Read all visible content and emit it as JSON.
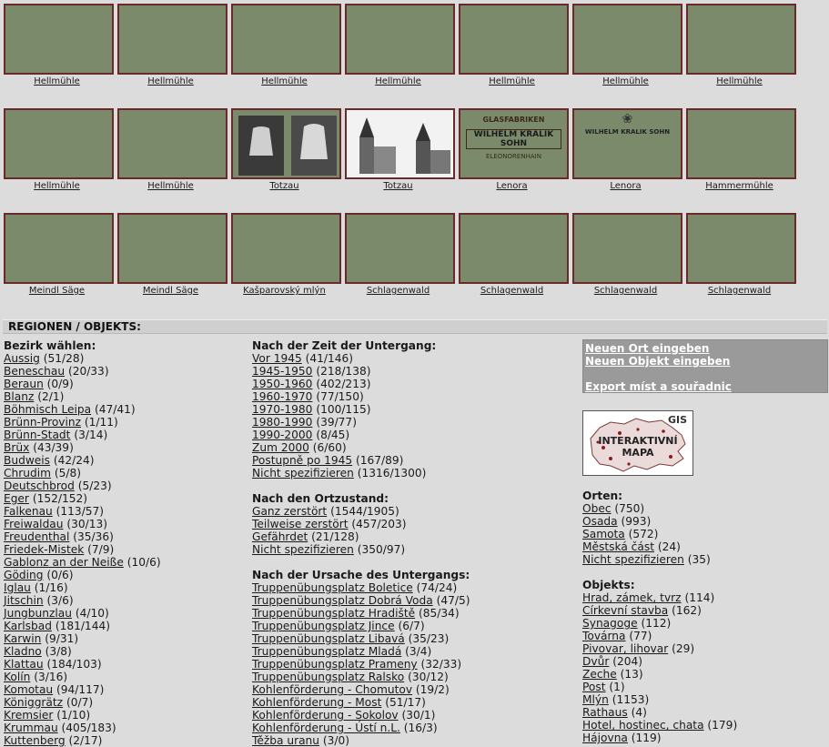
{
  "gallery": {
    "rows": [
      [
        {
          "caption": "Hellmühle",
          "img": "forest1"
        },
        {
          "caption": "Hellmühle",
          "img": "forest2"
        },
        {
          "caption": "Hellmühle",
          "img": "forest3"
        },
        {
          "caption": "Hellmühle",
          "img": "path"
        },
        {
          "caption": "Hellmühle",
          "img": "lake"
        },
        {
          "caption": "Hellmühle",
          "img": "light"
        },
        {
          "caption": "Hellmühle",
          "img": "green"
        }
      ],
      [
        {
          "caption": "Hellmühle",
          "img": "bw1"
        },
        {
          "caption": "Hellmühle",
          "img": "map"
        },
        {
          "caption": "Totzau",
          "img": "bells"
        },
        {
          "caption": "Totzau",
          "img": "church"
        },
        {
          "caption": "Lenora",
          "img": "label"
        },
        {
          "caption": "Lenora",
          "img": "label2"
        },
        {
          "caption": "Hammermühle",
          "img": "post"
        }
      ],
      [
        {
          "caption": "Meindl Säge",
          "img": "hills1"
        },
        {
          "caption": "Meindl Säge",
          "img": "hills2"
        },
        {
          "caption": "Kašparovský mlýn",
          "img": "sketch"
        },
        {
          "caption": "Schlagenwald",
          "img": "bldg"
        },
        {
          "caption": "Schlagenwald",
          "img": "town"
        },
        {
          "caption": "Schlagenwald",
          "img": "street"
        },
        {
          "caption": "Schlagenwald",
          "img": "street2"
        }
      ]
    ],
    "label_texts": {
      "glas": "GLASFABRIKEN",
      "wks": "WILHELM KRALIK SOHN",
      "eleo": "ELEONORENHAIN",
      "wks2": "WILHELM KRALIK SOHN"
    }
  },
  "section_title": "REGIONEN / OBJEKTS:",
  "bezirk": {
    "heading": "Bezirk wählen:",
    "items": [
      {
        "name": "Aussig",
        "count": "(51/28)"
      },
      {
        "name": "Beneschau",
        "count": "(20/33)"
      },
      {
        "name": "Beraun",
        "count": "(0/9)"
      },
      {
        "name": "Blanz",
        "count": "(2/1)"
      },
      {
        "name": "Böhmisch Leipa",
        "count": "(47/41)"
      },
      {
        "name": "Brünn-Provinz",
        "count": "(1/11)"
      },
      {
        "name": "Brünn-Stadt",
        "count": "(3/14)"
      },
      {
        "name": "Brüx",
        "count": "(43/39)"
      },
      {
        "name": "Budweis",
        "count": "(42/24)"
      },
      {
        "name": "Chrudim",
        "count": "(5/8)"
      },
      {
        "name": "Deutschbrod",
        "count": "(5/23)"
      },
      {
        "name": "Eger",
        "count": "(152/152)"
      },
      {
        "name": "Falkenau",
        "count": "(113/57)"
      },
      {
        "name": "Freiwaldau",
        "count": "(30/13)"
      },
      {
        "name": "Freudenthal",
        "count": "(35/36)"
      },
      {
        "name": "Friedek-Mistek",
        "count": "(7/9)"
      },
      {
        "name": "Gablonz an der Neiße",
        "count": "(10/6)"
      },
      {
        "name": "Göding",
        "count": "(0/6)"
      },
      {
        "name": "Iglau",
        "count": "(1/16)"
      },
      {
        "name": "Jitschin",
        "count": "(3/6)"
      },
      {
        "name": "Jungbunzlau",
        "count": "(4/10)"
      },
      {
        "name": "Karlsbad",
        "count": "(181/144)"
      },
      {
        "name": "Karwin",
        "count": "(9/31)"
      },
      {
        "name": "Kladno",
        "count": "(3/8)"
      },
      {
        "name": "Klattau",
        "count": "(184/103)"
      },
      {
        "name": "Kolín",
        "count": "(3/16)"
      },
      {
        "name": "Komotau",
        "count": "(94/117)"
      },
      {
        "name": "Königgrätz",
        "count": "(0/7)"
      },
      {
        "name": "Kremsier",
        "count": "(1/10)"
      },
      {
        "name": "Krummau",
        "count": "(405/183)"
      },
      {
        "name": "Kuttenberg",
        "count": "(2/17)"
      }
    ]
  },
  "zeit": {
    "heading": "Nach der Zeit der Untergang:",
    "items": [
      {
        "name": "Vor 1945",
        "count": "(41/146)"
      },
      {
        "name": "1945-1950",
        "count": "(218/138)"
      },
      {
        "name": "1950-1960",
        "count": "(402/213)"
      },
      {
        "name": "1960-1970",
        "count": "(77/150)"
      },
      {
        "name": "1970-1980",
        "count": "(100/115)"
      },
      {
        "name": "1980-1990",
        "count": "(39/77)"
      },
      {
        "name": "1990-2000",
        "count": "(8/45)"
      },
      {
        "name": "Zum 2000",
        "count": "(6/60)"
      },
      {
        "name": "Postupně po 1945",
        "count": "(167/89)"
      },
      {
        "name": "Nicht spezifizieren",
        "count": "(1316/1300)"
      }
    ]
  },
  "zustand": {
    "heading": "Nach den Ortzustand:",
    "items": [
      {
        "name": "Ganz zerstört",
        "count": "(1544/1905)"
      },
      {
        "name": "Teilweise zerstört",
        "count": "(457/203)"
      },
      {
        "name": "Gefährdet",
        "count": "(21/128)"
      },
      {
        "name": "Nicht spezifizieren",
        "count": "(350/97)"
      }
    ]
  },
  "ursache": {
    "heading": "Nach der Ursache des Untergangs:",
    "items": [
      {
        "name": "Truppenübungsplatz Boletice",
        "count": "(74/24)"
      },
      {
        "name": "Truppenübungsplatz Dobrá Voda",
        "count": "(47/5)"
      },
      {
        "name": "Truppenübungsplatz Hradiště",
        "count": "(85/34)"
      },
      {
        "name": "Truppenübungsplatz Jince",
        "count": "(6/7)"
      },
      {
        "name": "Truppenübungsplatz Libavá",
        "count": "(35/23)"
      },
      {
        "name": "Truppenübungsplatz Mladá",
        "count": "(3/4)"
      },
      {
        "name": "Truppenübungsplatz Prameny",
        "count": "(32/33)"
      },
      {
        "name": "Truppenübungsplatz Ralsko",
        "count": "(30/12)"
      },
      {
        "name": "Kohlenförderung - Chomutov",
        "count": "(19/2)"
      },
      {
        "name": "Kohlenförderung - Most",
        "count": "(51/17)"
      },
      {
        "name": "Kohlenförderung - Sokolov",
        "count": "(30/1)"
      },
      {
        "name": "Kohlenförderung - Ústí n.L.",
        "count": "(16/3)"
      },
      {
        "name": "Těžba uranu",
        "count": "(3/0)"
      }
    ]
  },
  "menu": {
    "items": [
      "Neuen Ort eingeben",
      "Neuen Objekt eingeben",
      "Export míst a souřadnic"
    ]
  },
  "gis": {
    "line1": "GIS",
    "line2": "INTERAKTIVNÍ",
    "line3": "MAPA"
  },
  "orten": {
    "heading": "Orten:",
    "items": [
      {
        "name": "Obec",
        "count": "(750)"
      },
      {
        "name": "Osada",
        "count": "(993)"
      },
      {
        "name": "Samota",
        "count": "(572)"
      },
      {
        "name": "Městská část",
        "count": "(24)"
      },
      {
        "name": "Nicht spezifizieren",
        "count": "(35)"
      }
    ]
  },
  "objekts": {
    "heading": "Objekts:",
    "items": [
      {
        "name": "Hrad, zámek, tvrz",
        "count": "(114)"
      },
      {
        "name": "Církevní stavba",
        "count": "(162)"
      },
      {
        "name": "Synagoge",
        "count": "(112)"
      },
      {
        "name": "Továrna",
        "count": "(77)"
      },
      {
        "name": "Pivovar, lihovar",
        "count": "(29)"
      },
      {
        "name": "Dvůr",
        "count": "(204)"
      },
      {
        "name": "Zeche",
        "count": "(13)"
      },
      {
        "name": "Post",
        "count": "(1)"
      },
      {
        "name": "Mlýn",
        "count": "(1153)"
      },
      {
        "name": "Rathaus",
        "count": "(4)"
      },
      {
        "name": "Hotel, hostinec, chata",
        "count": "(179)"
      },
      {
        "name": "Hájovna",
        "count": "(119)"
      }
    ]
  }
}
